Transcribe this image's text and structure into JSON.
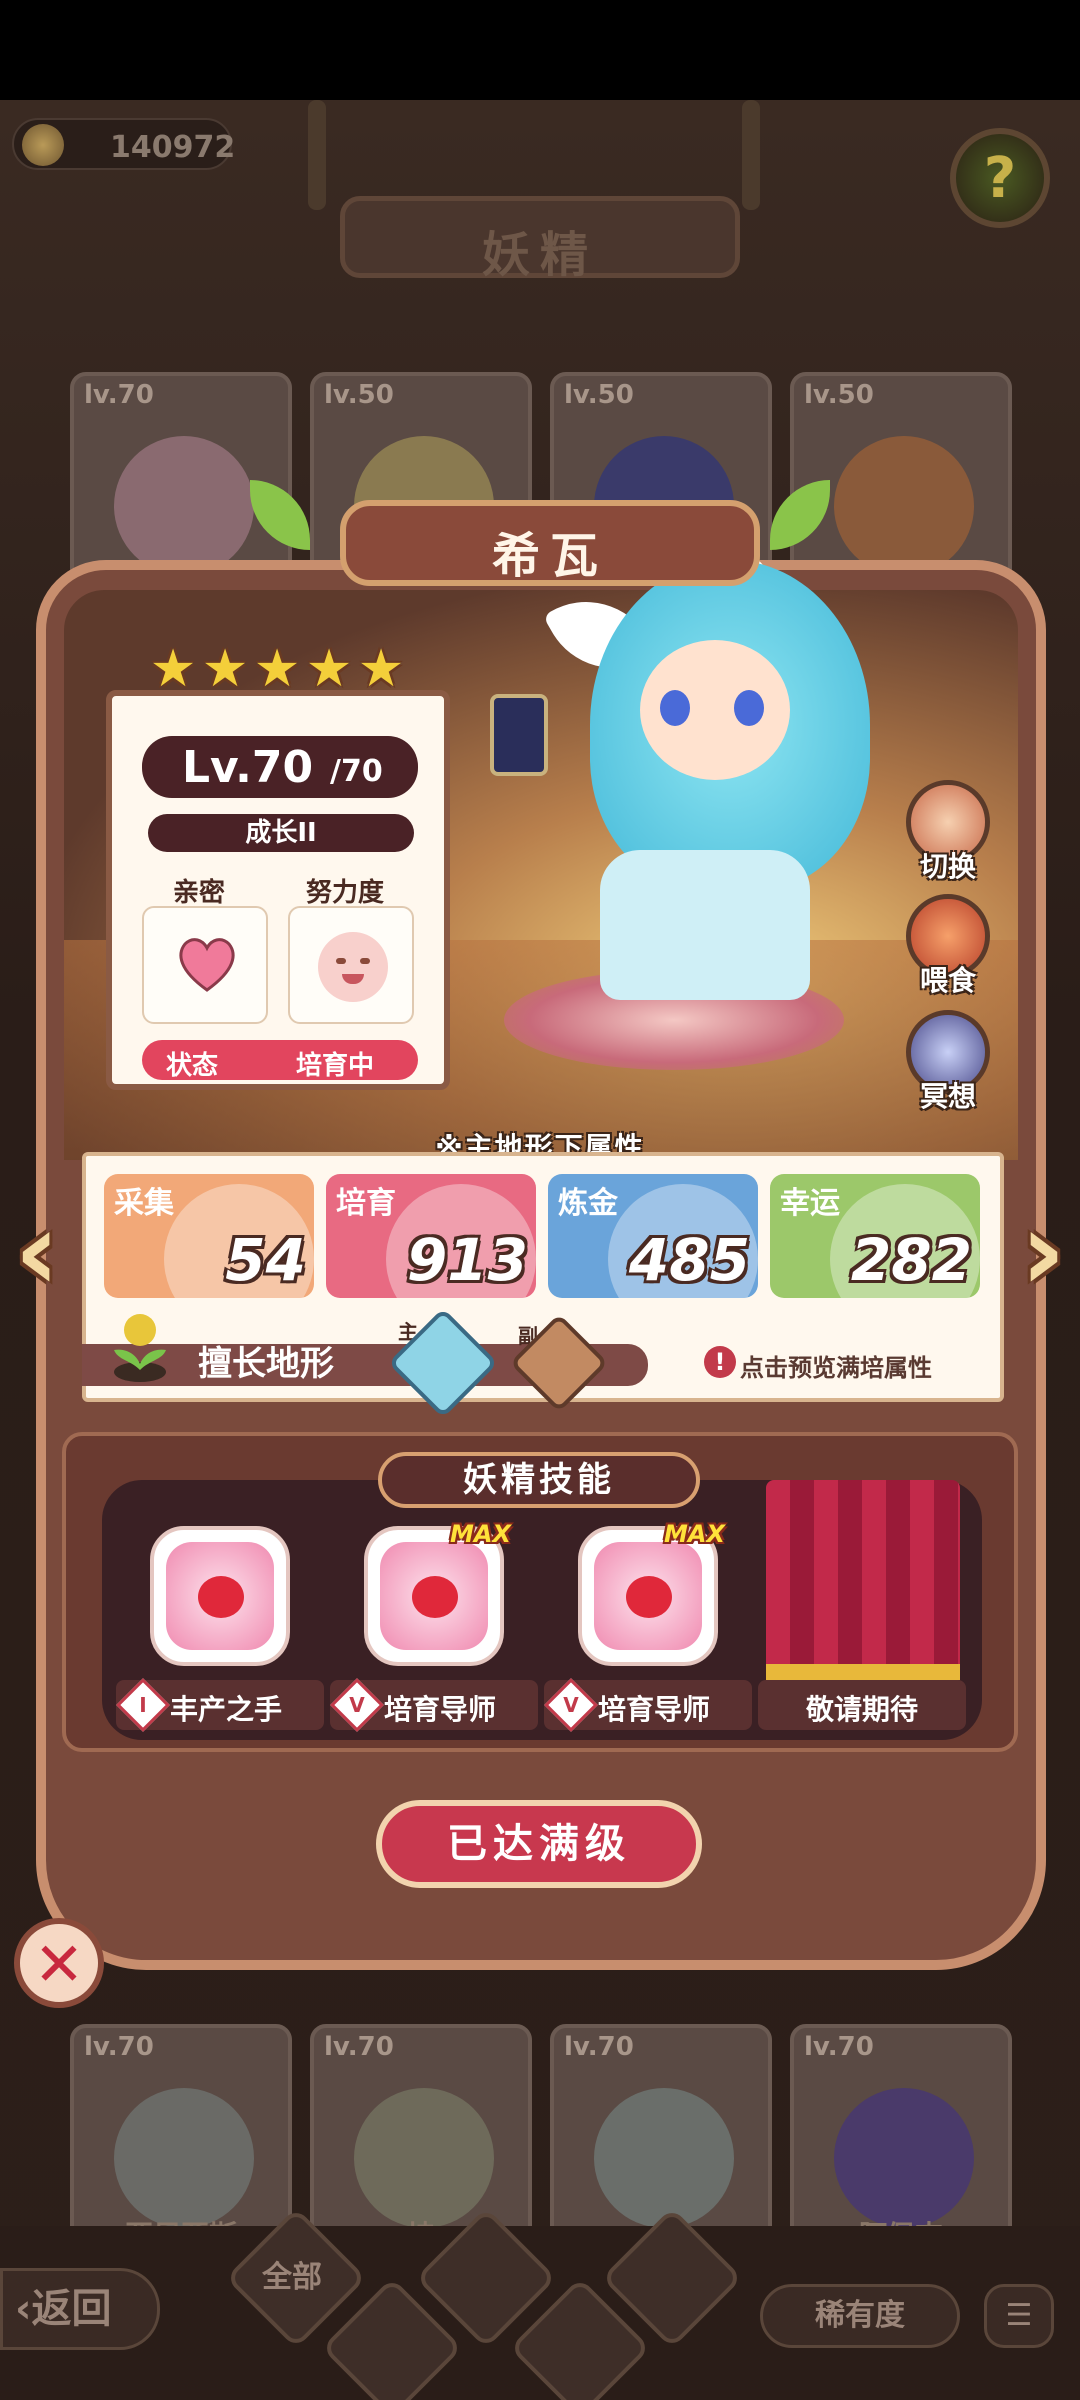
{
  "header": {
    "coins": "140972",
    "title": "妖精"
  },
  "background_cards_top": [
    {
      "level": "lv.70"
    },
    {
      "level": "lv.50"
    },
    {
      "level": "lv.50"
    },
    {
      "level": "lv.50"
    }
  ],
  "background_cards_bottom": [
    {
      "level": "lv.70",
      "name": "亚尼亚斯"
    },
    {
      "level": "lv.70",
      "name": "坤"
    },
    {
      "level": "lv.70",
      "name": ""
    },
    {
      "level": "lv.70",
      "name": "阿佩吉"
    }
  ],
  "fairy": {
    "name": "希瓦",
    "stars": 5,
    "level": "Lv.70",
    "level_max": "/70",
    "growth": "成长II",
    "intimacy_label": "亲密",
    "effort_label": "努力度",
    "status_label": "状态",
    "status_value": "培育中"
  },
  "side_actions": {
    "switch": "切换",
    "feed": "喂食",
    "meditate": "冥想"
  },
  "attributes": {
    "title": "※主地形下属性",
    "stats": [
      {
        "name": "采集",
        "value": "54",
        "color": "#f2a878"
      },
      {
        "name": "培育",
        "value": "913",
        "color": "#e86a82"
      },
      {
        "name": "炼金",
        "value": "485",
        "color": "#6aa4da"
      },
      {
        "name": "幸运",
        "value": "282",
        "color": "#9cc86a"
      }
    ],
    "terrain_label": "擅长地形",
    "main_tag": "主",
    "sub_tag": "副",
    "preview_hint": "点击预览满培属性"
  },
  "skills": {
    "title": "妖精技能",
    "items": [
      {
        "name": "丰产之手",
        "grade": "I",
        "max": ""
      },
      {
        "name": "培育导师",
        "grade": "V",
        "max": "MAX"
      },
      {
        "name": "培育导师",
        "grade": "V",
        "max": "MAX"
      }
    ],
    "locked_label": "敬请期待"
  },
  "max_level_button": "已达满级",
  "bottom_nav": {
    "back": "返回",
    "all": "全部",
    "rarity": "稀有度"
  },
  "colors": {
    "modal_border": "#c88e6e",
    "status_red": "#e2455e",
    "max_button": "#c8384e"
  }
}
